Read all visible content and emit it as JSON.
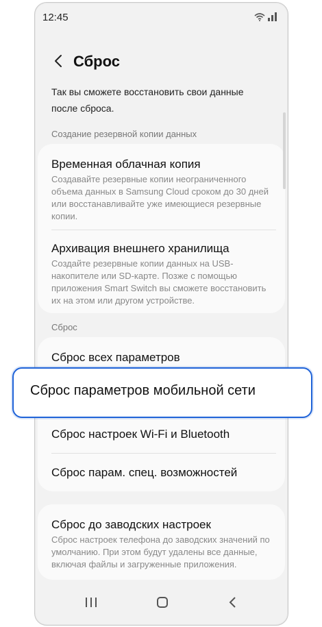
{
  "status_bar": {
    "time": "12:45"
  },
  "header": {
    "title": "Сброс"
  },
  "intro": "Так вы сможете восстановить свои данные после сброса.",
  "backup_section": {
    "label": "Создание резервной копии данных",
    "items": [
      {
        "title": "Временная облачная копия",
        "subtitle": "Создавайте резервные копии неограниченного объема данных в Samsung Cloud сроком до 30 дней или восстанавливайте уже имеющиеся резервные копии."
      },
      {
        "title": "Архивация внешнего хранилища",
        "subtitle": "Создайте резервные копии данных на USB-накопителе или SD-карте. Позже с помощью приложения Smart Switch вы сможете восстановить их на этом или другом устройстве."
      }
    ]
  },
  "reset_section": {
    "label": "Сброс",
    "items": [
      {
        "title": "Сброс всех параметров"
      },
      {
        "title": "Сброс параметров мобильной сети"
      },
      {
        "title": "Сброс настроек Wi-Fi и Bluetooth"
      },
      {
        "title": "Сброс парам. спец. возможностей"
      }
    ]
  },
  "factory_reset": {
    "title": "Сброс до заводских настроек",
    "subtitle": "Сброс настроек телефона до заводских значений по умолчанию. При этом будут удалены все данные, включая файлы и загруженные приложения."
  },
  "icons": {
    "back": "chevron-left-icon",
    "wifi": "wifi-icon",
    "signal": "signal-icon",
    "nav_recents": "recents-icon",
    "nav_home": "home-icon",
    "nav_back": "back-icon"
  },
  "colors": {
    "highlight_border": "#1f63d8",
    "background": "#f2f2f2",
    "card": "#fafafa"
  }
}
